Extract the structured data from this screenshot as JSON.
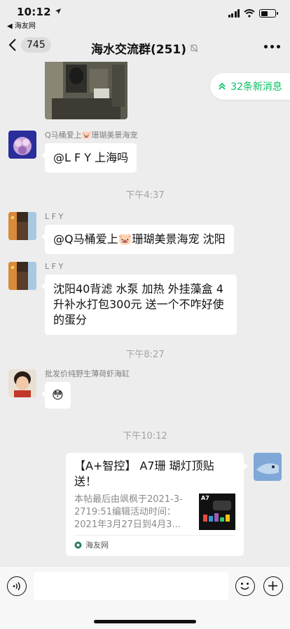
{
  "status_bar": {
    "time": "10:12",
    "back_app": "◀ 海友网",
    "battery_level": 0.5
  },
  "nav": {
    "back_count": "745",
    "title": "海水交流群(251)"
  },
  "new_messages": {
    "label": "32条新消息"
  },
  "messages": [
    {
      "sender": "Q马桶爱上🐷珊瑚美景海宠",
      "text": "@L F Y 上海吗"
    },
    {
      "sender": "L F Y",
      "text": "@Q马桶爱上🐷珊瑚美景海宠 沈阳"
    },
    {
      "sender": "L F Y",
      "text": "沈阳40背滤 水泵 加热 外挂藻盒 4升补水打包300元 送一个不咋好使的蛋分"
    },
    {
      "sender": "批发价纯野生薄荷虾海缸",
      "text": "😳"
    }
  ],
  "timestamps": [
    "下午4:37",
    "下午8:27",
    "下午10:12"
  ],
  "link_card": {
    "title": "【A+智控】 A7珊 瑚灯顶贴送！",
    "description": "本帖最后由飒枫于2021-3-2719:51编辑活动时间：2021年3月27日到4月3...",
    "thumb_label": "A7",
    "source": "海友网"
  },
  "input": {
    "placeholder": ""
  },
  "colors": {
    "accent_green": "#07C160",
    "background": "#EDEDED",
    "bubble": "#FFFFFF"
  }
}
